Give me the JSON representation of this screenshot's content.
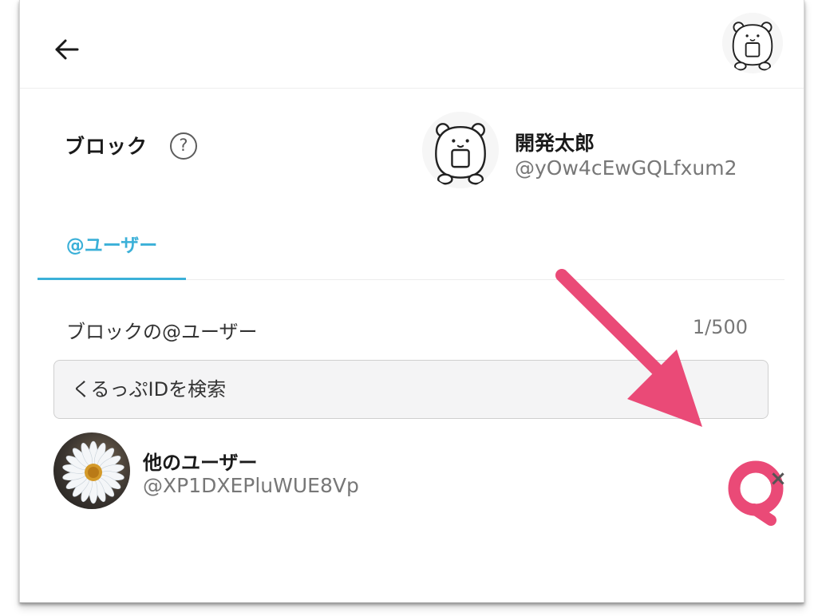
{
  "header": {
    "back_icon": "arrow-left-icon",
    "account_avatar": "bear-avatar"
  },
  "section": {
    "title": "ブロック",
    "help_icon": "question-circle-icon",
    "help_glyph": "?"
  },
  "profile": {
    "name": "開発太郎",
    "handle": "@yOw4cEwGQLfxum2"
  },
  "tabs": [
    {
      "label": "@ユーザー",
      "active": true
    }
  ],
  "block_list": {
    "label": "ブロックの@ユーザー",
    "count": "1/500",
    "search_placeholder": "くるっぷIDを検索",
    "users": [
      {
        "name": "他のユーザー",
        "handle": "@XP1DXEPluWUE8Vp",
        "avatar": "daisy-flower-photo",
        "remove_icon": "close-icon",
        "remove_glyph": "×"
      }
    ]
  },
  "colors": {
    "accent": "#3bb0d8",
    "annotation_arrow": "#ea4a77",
    "secondary_text": "#777777"
  }
}
